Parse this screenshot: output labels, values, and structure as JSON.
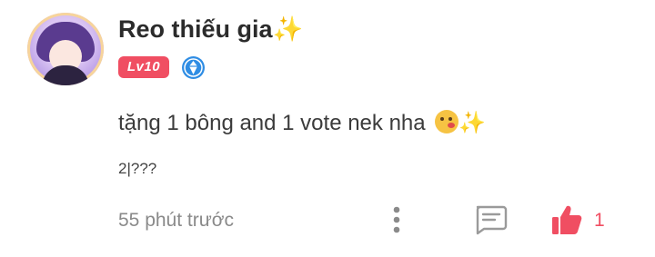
{
  "comment": {
    "username": "Reo thiếu gia",
    "username_emoji": "✨",
    "level_badge": "Lv10",
    "verified_icon": "diamond-badge-icon",
    "text": "tặng 1 bông and 1 vote nek nha",
    "text_emoji": "✨",
    "sub_text": "2|???",
    "timestamp": "55 phút trước",
    "like_count": "1"
  },
  "colors": {
    "accent": "#f04e62",
    "verified": "#2f8de4",
    "muted_text": "#8a8a8a",
    "sparkle": "#f4c23b"
  },
  "icons": {
    "more": "more-vertical-icon",
    "reply": "comment-icon",
    "like": "thumbs-up-icon"
  }
}
